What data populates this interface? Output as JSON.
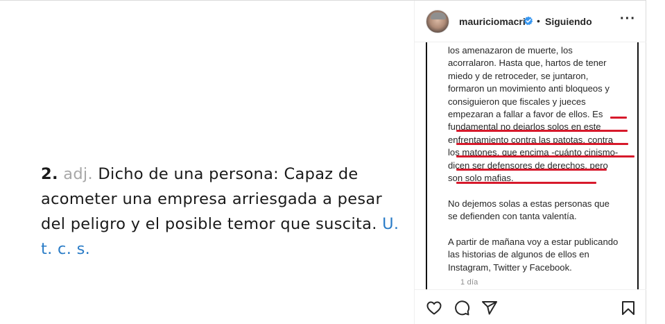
{
  "definition": {
    "number": "2.",
    "abbr": "adj.",
    "text": "Dicho de una persona: Capaz de acometer una empresa arriesgada a pesar del peligro y el posible temor que suscita.",
    "link": "U. t. c. s."
  },
  "header": {
    "username": "mauriciomacri",
    "separator": "•",
    "follow_status": "Siguiendo",
    "more_label": "···"
  },
  "caption": {
    "paragraphs": [
      "los amenazaron de muerte, los acorralaron. Hasta que, hartos de tener miedo y de retroceder, se juntaron, formaron un movimiento anti bloqueos y consiguieron que fiscales y jueces empezaran a fallar a favor de ellos. Es fundamental no dejarlos solos en este enfrentamiento contra las patotas, contra los matones, que encima -cuánto cinismo- dicen ser defensores de derechos, pero son solo mafias.",
      "No dejemos solas a estas personas que se defienden con tanta valentía.",
      "A partir de mañana voy a estar publicando las historias de algunos de ellos en Instagram, Twitter y Facebook."
    ],
    "timestamp": "1 día"
  },
  "colors": {
    "link_blue": "#2a7cc7",
    "highlight_red": "#d7192b",
    "verified_blue": "#3897f0"
  },
  "actions": {
    "icons": [
      "heart-icon",
      "comment-icon",
      "share-icon",
      "bookmark-icon"
    ]
  }
}
